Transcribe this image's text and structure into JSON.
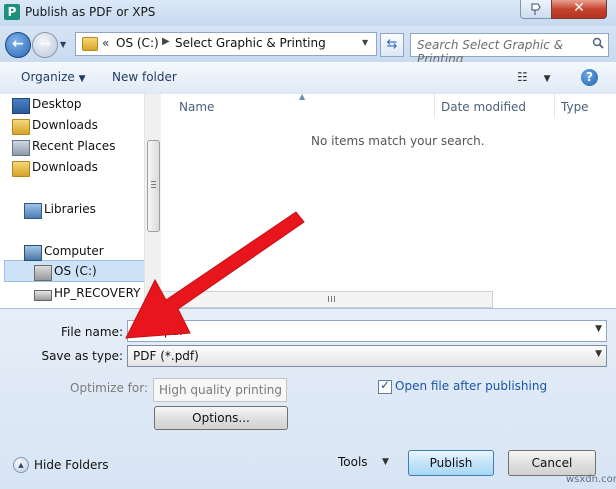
{
  "window": {
    "title": "Publish as PDF or XPS",
    "app_icon_letter": "P"
  },
  "address": {
    "prefix": "«",
    "segments": [
      "OS (C:)",
      "Select Graphic & Printing"
    ],
    "search_placeholder": "Search Select Graphic & Printing"
  },
  "toolbar": {
    "organize": "Organize",
    "new_folder": "New folder"
  },
  "sidebar": {
    "items": [
      {
        "label": "Desktop",
        "icon": "desktop-icon"
      },
      {
        "label": "Downloads",
        "icon": "folder-icon"
      },
      {
        "label": "Recent Places",
        "icon": "recent-places-icon"
      },
      {
        "label": "Downloads",
        "icon": "folder-icon"
      },
      {
        "label": "Libraries",
        "icon": "libraries-icon"
      },
      {
        "label": "Computer",
        "icon": "computer-icon"
      },
      {
        "label": "OS (C:)",
        "icon": "drive-icon"
      },
      {
        "label": "HP_RECOVERY (D",
        "icon": "drive-icon"
      }
    ]
  },
  "filelist": {
    "columns": [
      "Name",
      "Date modified",
      "Type"
    ],
    "empty_message": "No items match your search."
  },
  "form": {
    "file_name_label": "File name:",
    "file_name_value": ".pdf",
    "save_type_label": "Save as type:",
    "save_type_value": "PDF (*.pdf)",
    "optimize_label": "Optimize for:",
    "optimize_value": "High quality printing",
    "options_button": "Options...",
    "open_after_label": "Open file after publishing",
    "open_after_checked": true
  },
  "footer": {
    "hide_folders": "Hide Folders",
    "tools": "Tools",
    "publish": "Publish",
    "cancel": "Cancel"
  },
  "watermark": "wsxdn.com",
  "colors": {
    "annotation_arrow": "#e8161c",
    "selection": "#cfe3f8",
    "link_blue": "#1b55a6"
  }
}
